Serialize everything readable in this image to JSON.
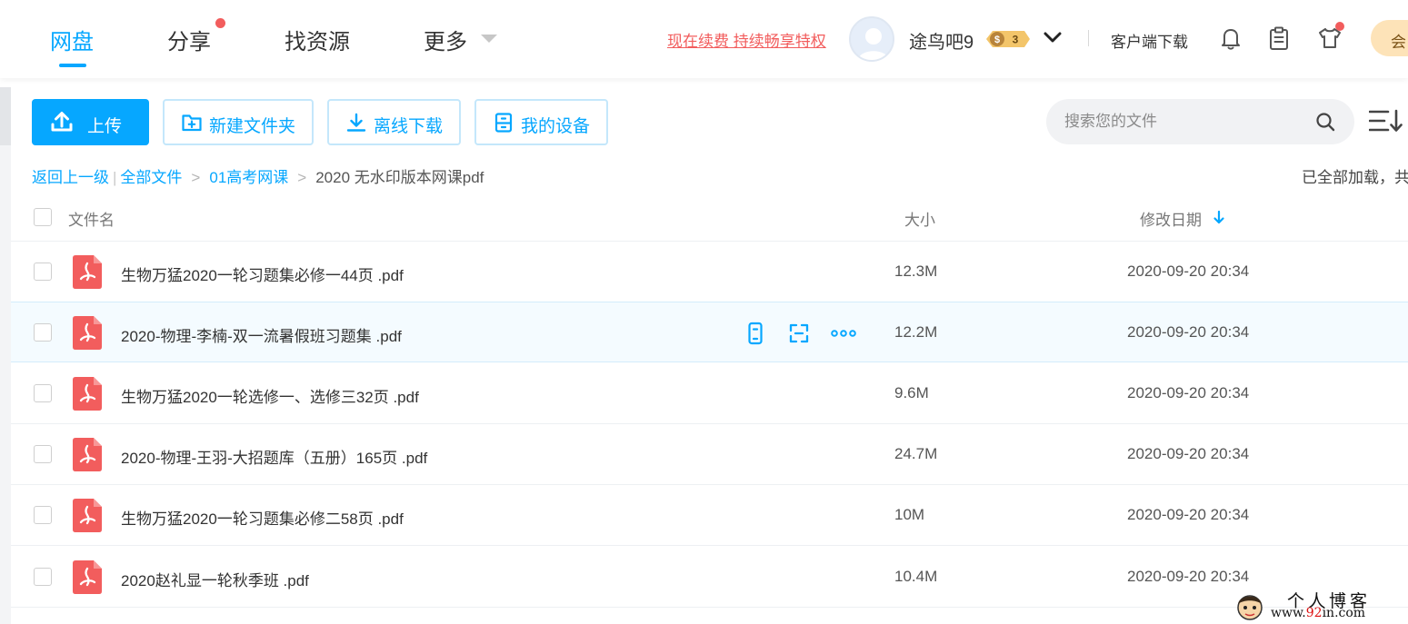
{
  "nav": {
    "tabs": [
      {
        "label": "网盘",
        "active": true
      },
      {
        "label": "分享",
        "has_dot": true
      },
      {
        "label": "找资源"
      },
      {
        "label": "更多"
      }
    ],
    "promo_link": "现在续费 持续畅享特权",
    "username": "途鸟吧9",
    "vip_level": "3",
    "client_download": "客户端下载",
    "member_label": "会",
    "icons": [
      "bell-icon",
      "clipboard-icon",
      "shirt-icon"
    ]
  },
  "toolbar": {
    "upload": "上传",
    "new_folder": "新建文件夹",
    "offline_download": "离线下载",
    "my_devices": "我的设备",
    "search_placeholder": "搜索您的文件"
  },
  "breadcrumb": {
    "back": "返回上一级",
    "items": [
      "全部文件",
      "01高考网课"
    ],
    "current": "2020 无水印版本网课pdf",
    "status": "已全部加载，共"
  },
  "table": {
    "headers": {
      "name": "文件名",
      "size": "大小",
      "date": "修改日期"
    },
    "sorted_by": "date",
    "sort_direction": "desc",
    "rows": [
      {
        "name": "生物万猛2020一轮习题集必修一44页 .pdf",
        "size": "12.3M",
        "date": "2020-09-20 20:34"
      },
      {
        "name": "2020-物理-李楠-双一流暑假班习题集 .pdf",
        "size": "12.2M",
        "date": "2020-09-20 20:34",
        "hovered": true
      },
      {
        "name": "生物万猛2020一轮选修一、选修三32页 .pdf",
        "size": "9.6M",
        "date": "2020-09-20 20:34"
      },
      {
        "name": "2020-物理-王羽-大招题库（五册）165页 .pdf",
        "size": "24.7M",
        "date": "2020-09-20 20:34"
      },
      {
        "name": "生物万猛2020一轮习题集必修二58页 .pdf",
        "size": "10M",
        "date": "2020-09-20 20:34"
      },
      {
        "name": "2020赵礼显一轮秋季班 .pdf",
        "size": "10.4M",
        "date": "2020-09-20 20:34"
      }
    ],
    "row_actions": [
      "phone-icon",
      "share-icon",
      "more-icon"
    ]
  },
  "watermark": {
    "title": "个人博客",
    "url_prefix": "www.",
    "url_highlight": "92",
    "url_suffix": "in.com"
  },
  "colors": {
    "accent": "#06a7ff",
    "alert": "#f25d5d",
    "pdf": "#f25d5d"
  }
}
